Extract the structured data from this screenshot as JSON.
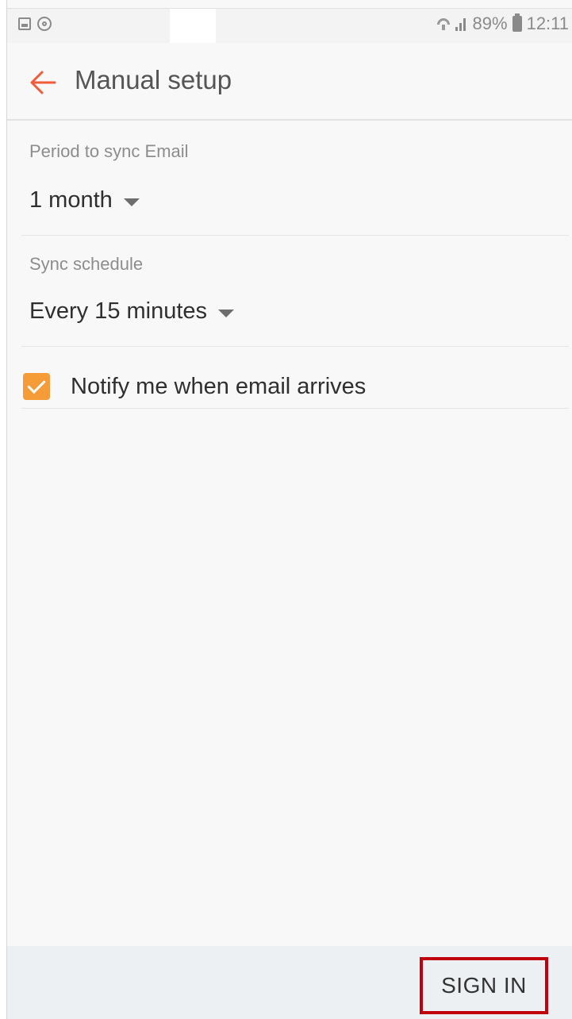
{
  "status_bar": {
    "battery_percent": "89%",
    "time": "12:11",
    "icons": [
      "gallery-icon",
      "sync-icon",
      "wifi-icon",
      "signal-icon",
      "battery-icon"
    ]
  },
  "header": {
    "back_icon": "back-arrow-icon",
    "title": "Manual setup"
  },
  "settings": {
    "sync_period": {
      "label": "Period to sync Email",
      "value": "1 month"
    },
    "sync_schedule": {
      "label": "Sync schedule",
      "value": "Every 15 minutes"
    },
    "notify": {
      "label": "Notify me when email arrives",
      "checked": true
    }
  },
  "footer": {
    "sign_in_label": "SIGN IN"
  },
  "colors": {
    "accent": "#f15a3a",
    "checkbox": "#f59b37",
    "highlight_border": "#c0000b"
  }
}
